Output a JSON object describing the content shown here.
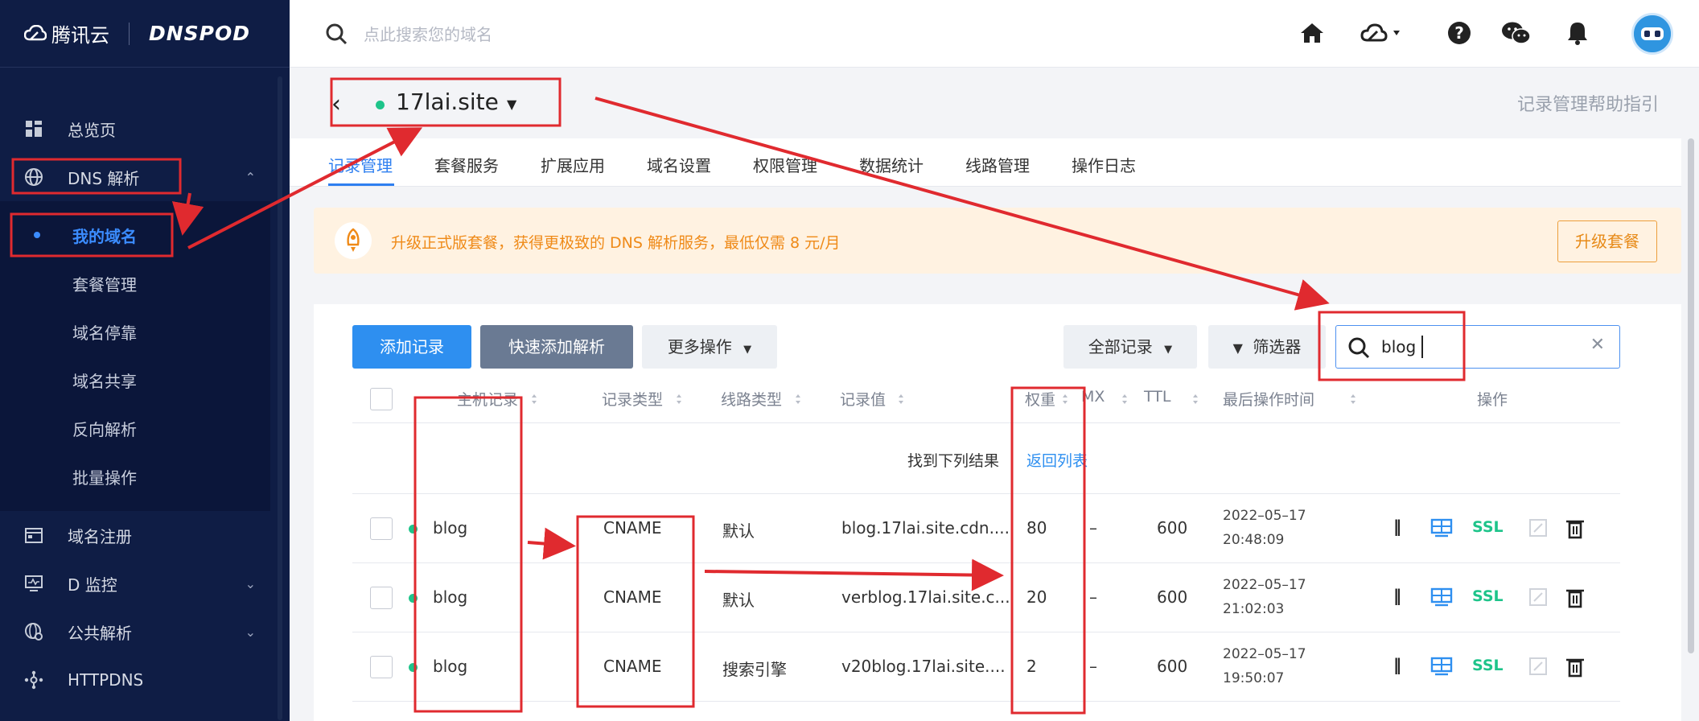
{
  "app": {
    "brand_tencent": "腾讯云",
    "brand_dnspod": "DNSPOD"
  },
  "topbar": {
    "search_placeholder": "点此搜索您的域名",
    "icons": [
      "home-icon",
      "cloud-icon",
      "help-icon",
      "wechat-icon",
      "bell-icon",
      "avatar"
    ]
  },
  "sidebar": {
    "items": [
      {
        "label": "总览页",
        "icon": "dashboard-icon"
      },
      {
        "label": "DNS 解析",
        "icon": "globe-icon",
        "expanded": true
      },
      {
        "label": "域名注册",
        "icon": "calendar-icon"
      },
      {
        "label": "D 监控",
        "icon": "monitor-icon"
      },
      {
        "label": "公共解析",
        "icon": "public-dns-icon"
      },
      {
        "label": "HTTPDNS",
        "icon": "httpdns-icon"
      }
    ],
    "sub_items": [
      {
        "label": "我的域名",
        "active": true
      },
      {
        "label": "套餐管理"
      },
      {
        "label": "域名停靠"
      },
      {
        "label": "域名共享"
      },
      {
        "label": "反向解析"
      },
      {
        "label": "批量操作"
      }
    ]
  },
  "domain": {
    "name": "17lai.site",
    "status_color": "#1ec48a",
    "help_link": "记录管理帮助指引"
  },
  "tabs": [
    "记录管理",
    "套餐服务",
    "扩展应用",
    "域名设置",
    "权限管理",
    "数据统计",
    "线路管理",
    "操作日志"
  ],
  "promo": {
    "text": "升级正式版套餐，获得更极致的 DNS 解析服务，最低仅需 8 元/月",
    "button": "升级套餐"
  },
  "toolbar": {
    "add_record": "添加记录",
    "quick_add": "快速添加解析",
    "more_ops": "更多操作",
    "all_records": "全部记录",
    "filter": "筛选器",
    "search_value": "blog"
  },
  "table": {
    "headers": [
      "主机记录",
      "记录类型",
      "线路类型",
      "记录值",
      "权重",
      "MX",
      "TTL",
      "最后操作时间",
      "操作"
    ],
    "notice": "找到下列结果",
    "notice_link": "返回列表",
    "rows": [
      {
        "host": "blog",
        "type": "CNAME",
        "line": "默认",
        "value": "blog.17lai.site.cdn....",
        "weight": "80",
        "mx": "–",
        "ttl": "600",
        "date": "2022–05–17",
        "time": "20:48:09",
        "ssl": "SSL"
      },
      {
        "host": "blog",
        "type": "CNAME",
        "line": "默认",
        "value": "verblog.17lai.site.c...",
        "weight": "20",
        "mx": "–",
        "ttl": "600",
        "date": "2022–05–17",
        "time": "21:02:03",
        "ssl": "SSL"
      },
      {
        "host": "blog",
        "type": "CNAME",
        "line": "搜索引擎",
        "value": "v20blog.17lai.site....",
        "weight": "2",
        "mx": "–",
        "ttl": "600",
        "date": "2022–05–17",
        "time": "19:50:07",
        "ssl": "SSL"
      }
    ]
  },
  "colors": {
    "sidebar_bg": "#0f1d45",
    "accent": "#2e8ff0",
    "annotation_red": "#e02a2f",
    "promo_orange": "#ef8a18",
    "ssl_green": "#1ec48a"
  }
}
